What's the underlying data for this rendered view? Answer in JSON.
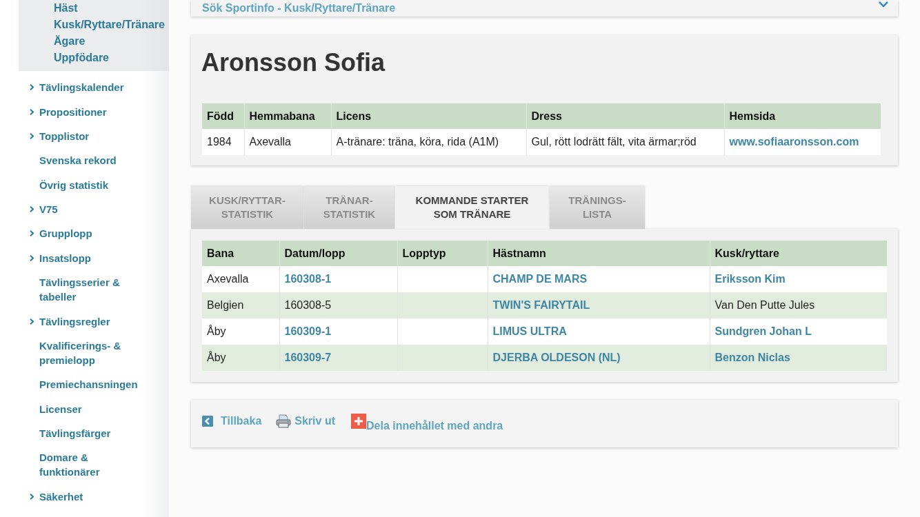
{
  "sidebar": {
    "submenu": [
      "Häst",
      "Kusk/Ryttare/Tränare",
      "Ägare",
      "Uppfödare"
    ],
    "items": [
      {
        "label": "Tävlingskalender",
        "expandable": true
      },
      {
        "label": "Propositioner",
        "expandable": true
      },
      {
        "label": "Topplistor",
        "expandable": true
      },
      {
        "label": "Svenska rekord",
        "expandable": false
      },
      {
        "label": "Övrig statistik",
        "expandable": false
      },
      {
        "label": "V75",
        "expandable": true
      },
      {
        "label": "Grupplopp",
        "expandable": true
      },
      {
        "label": "Insatslopp",
        "expandable": true
      },
      {
        "label": "Tävlingsserier & tabeller",
        "expandable": false
      },
      {
        "label": "Tävlingsregler",
        "expandable": true
      },
      {
        "label": "Kvalificerings- & premielopp",
        "expandable": false
      },
      {
        "label": "Premiechansningen",
        "expandable": false
      },
      {
        "label": "Licenser",
        "expandable": false
      },
      {
        "label": "Tävlingsfärger",
        "expandable": false
      },
      {
        "label": "Domare & funktionärer",
        "expandable": false
      },
      {
        "label": "Säkerhet",
        "expandable": true
      }
    ]
  },
  "search_panel": {
    "title": "Sök Sportinfo - Kusk/Ryttare/Tränare"
  },
  "profile": {
    "name": "Aronsson Sofia",
    "columns": [
      "Född",
      "Hemmabana",
      "Licens",
      "Dress",
      "Hemsida"
    ],
    "rows": [
      [
        {
          "text": "1984",
          "link": false
        },
        {
          "text": "Axevalla",
          "link": false
        },
        {
          "text": "A-tränare: träna, köra, rida (A1M)",
          "link": false
        },
        {
          "text": "Gul, rött lodrätt fält, vita ärmar;röd",
          "link": false
        },
        {
          "text": "www.sofiaaronsson.com",
          "link": true
        }
      ]
    ]
  },
  "tabs": [
    {
      "label": "KUSK/RYTTAR-STATISTIK",
      "selected": false
    },
    {
      "label": "TRÄNAR-STATISTIK",
      "selected": false
    },
    {
      "label": "KOMMANDE STARTER SOM TRÄNARE",
      "selected": true
    },
    {
      "label": "TRÄNINGS-LISTA",
      "selected": false
    }
  ],
  "starts_table": {
    "columns": [
      "Bana",
      "Datum/lopp",
      "Lopptyp",
      "Hästnamn",
      "Kusk/ryttare"
    ],
    "rows": [
      [
        {
          "text": "Axevalla",
          "link": false
        },
        {
          "text": "160308-1",
          "link": true
        },
        null,
        {
          "text": "CHAMP DE MARS",
          "link": true
        },
        {
          "text": "Eriksson Kim",
          "link": true
        }
      ],
      [
        {
          "text": "Belgien",
          "link": false
        },
        {
          "text": "160308-5",
          "link": false
        },
        null,
        {
          "text": "TWIN'S FAIRYTAIL",
          "link": true
        },
        {
          "text": "Van Den Putte Jules",
          "link": false
        }
      ],
      [
        {
          "text": "Åby",
          "link": false
        },
        {
          "text": "160309-1",
          "link": true
        },
        null,
        {
          "text": "LIMUS ULTRA",
          "link": true
        },
        {
          "text": "Sundgren Johan L",
          "link": true
        }
      ],
      [
        {
          "text": "Åby",
          "link": false
        },
        {
          "text": "160309-7",
          "link": true
        },
        null,
        {
          "text": "DJERBA OLDESON (NL)",
          "link": true
        },
        {
          "text": "Benzon Niclas",
          "link": true
        }
      ]
    ]
  },
  "actions": [
    {
      "label": "Tillbaka",
      "kind": "back"
    },
    {
      "label": "Skriv ut",
      "kind": "print"
    },
    {
      "label": "Dela innehållet med andra",
      "kind": "share"
    }
  ]
}
